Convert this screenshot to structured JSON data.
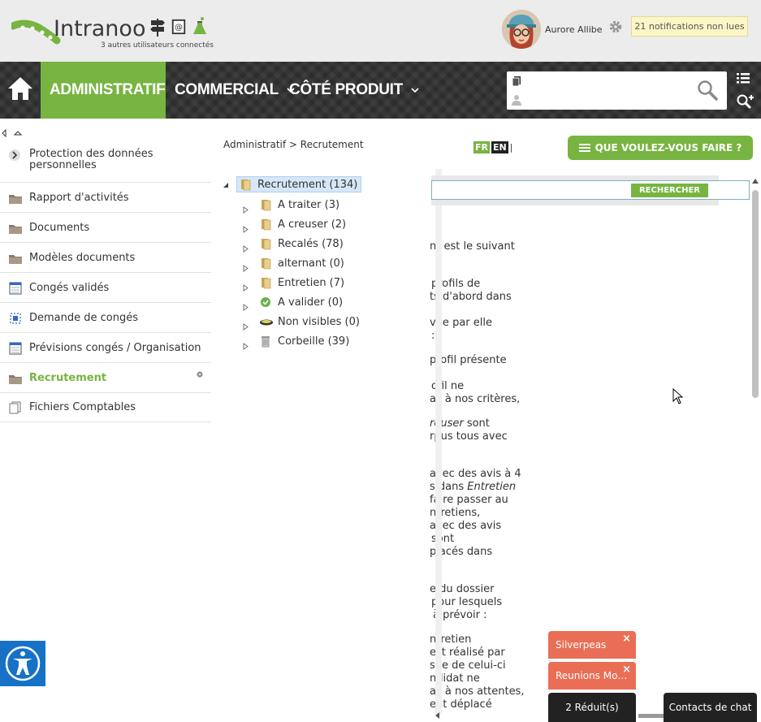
{
  "app": {
    "logo_text": "Intranoo",
    "connected_users": "3 autres utilisateurs connectés"
  },
  "header": {
    "user_name": "Aurore Allibe",
    "notifications": "21 notifications non lues",
    "icons": [
      "signpost-icon",
      "contact-book-icon",
      "flask-icon"
    ]
  },
  "nav": {
    "items": [
      {
        "label": "ADMINISTRATIF",
        "active": true
      },
      {
        "label": "COMMERCIAL",
        "active": false
      },
      {
        "label": "CÔTÉ PRODUIT",
        "active": false
      }
    ]
  },
  "sidebar": {
    "items": [
      {
        "label": "Protection des données",
        "label2": "personnelles",
        "icon": "chevron-right-icon"
      },
      {
        "label": "Rapport d'activités",
        "icon": "folder-icon"
      },
      {
        "label": "Documents",
        "icon": "folder-icon"
      },
      {
        "label": "Modèles documents",
        "icon": "folder-icon"
      },
      {
        "label": "Congés validés",
        "icon": "calendar-icon"
      },
      {
        "label": "Demande de congés",
        "icon": "selection-icon"
      },
      {
        "label": "Prévisions congés / Organisation",
        "icon": "calendar-icon"
      },
      {
        "label": "Recrutement",
        "icon": "folder-icon",
        "active": true
      },
      {
        "label": "Fichiers Comptables",
        "icon": "files-icon"
      }
    ]
  },
  "breadcrumb": {
    "path": "Administratif > Recrutement"
  },
  "lang": {
    "fr": "FR",
    "en": "EN",
    "sep": "|"
  },
  "action_button": "QUE VOULEZ-VOUS FAIRE ?",
  "tree": {
    "root": "Recrutement (134)",
    "children": [
      {
        "label": "A traiter (3)",
        "icon": "folder-icon"
      },
      {
        "label": "A creuser (2)",
        "icon": "folder-icon"
      },
      {
        "label": "Recalés (78)",
        "icon": "folder-icon"
      },
      {
        "label": "alternant (0)",
        "icon": "folder-icon"
      },
      {
        "label": "Entretien (7)",
        "icon": "folder-icon"
      },
      {
        "label": "A valider (0)",
        "icon": "check-icon"
      },
      {
        "label": "Non visibles (0)",
        "icon": "eye-icon"
      },
      {
        "label": "Corbeille (39)",
        "icon": "trash-icon"
      }
    ]
  },
  "panel": {
    "search_button": "RECHERCHER",
    "lines": [
      "nt est le suivant",
      "profils de",
      "ts d'abord dans",
      "vue par elle",
      ":",
      "profil présente",
      "ofil ne",
      "as à nos critères,",
      "reuser sont",
      "rpus tous avec",
      "avec des avis à 4",
      "s dans Entretien",
      "faire passer au",
      "ntretiens,",
      "avec des avis",
      "sont",
      "placés dans",
      "e du dossier",
      "pour lesquels",
      "à prévoir :",
      "ntretien",
      "est réalisé par",
      "sue de celui-ci",
      "ndidat ne",
      "as à nos attentes,",
      "ent déplacé"
    ]
  },
  "bottom": {
    "tabs": [
      "Silverpeas",
      "Reunions Mo…"
    ],
    "reduced": "2 Réduit(s)",
    "chat": "Contacts de chat"
  }
}
